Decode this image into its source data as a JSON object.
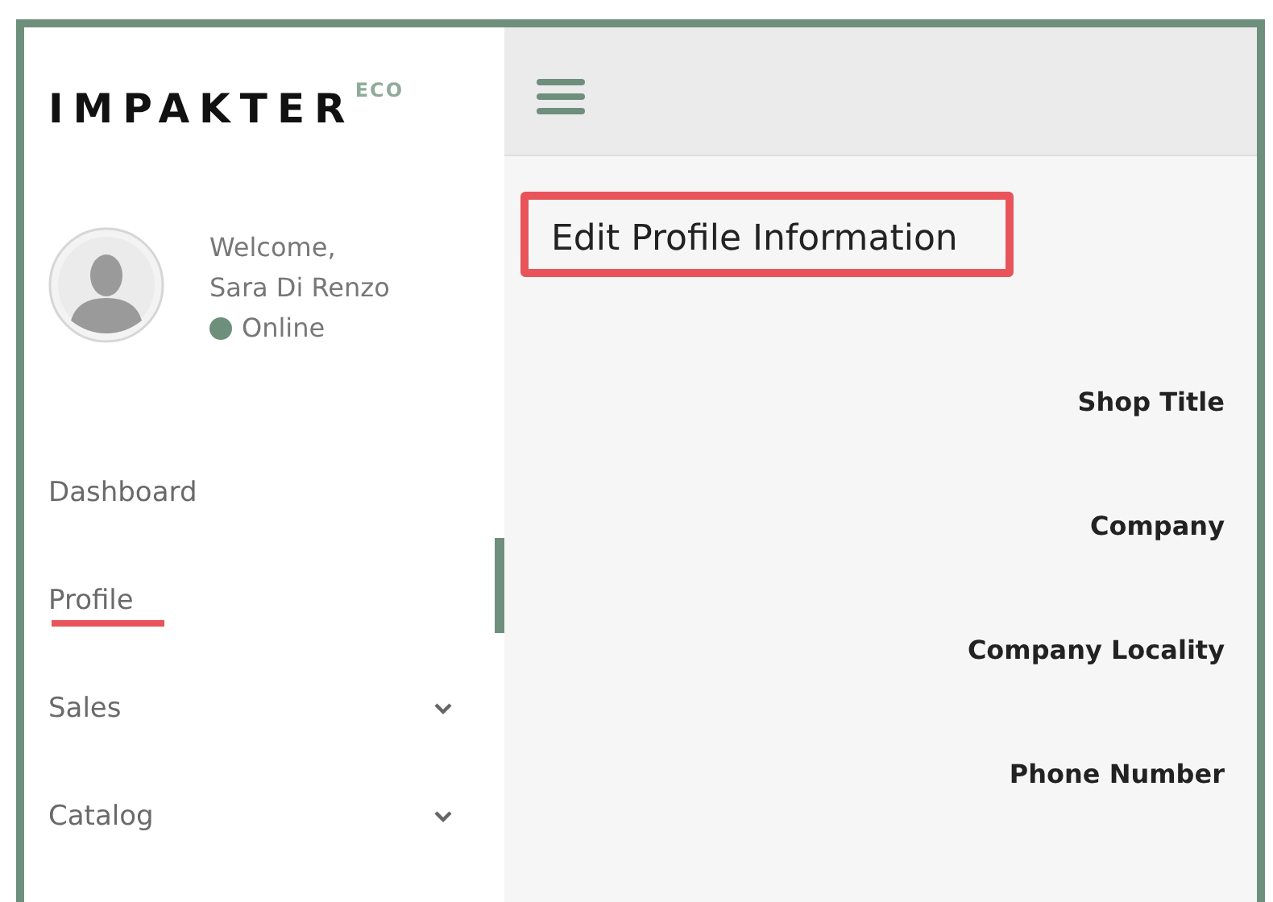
{
  "sidebar": {
    "logo": {
      "wordmark": "IMPAKTER",
      "superscript": "ECO"
    },
    "user": {
      "greeting": "Welcome,",
      "name": "Sara Di Renzo",
      "status": "Online",
      "online": true
    },
    "items": [
      {
        "label": "Dashboard",
        "expandable": false,
        "annotated": false
      },
      {
        "label": "Profile",
        "expandable": false,
        "annotated": true
      },
      {
        "label": "Sales",
        "expandable": true,
        "annotated": false
      },
      {
        "label": "Catalog",
        "expandable": true,
        "annotated": false
      }
    ]
  },
  "main": {
    "heading": {
      "text": "Edit Profile Information",
      "annotated": true
    },
    "form_labels": [
      "Shop Title",
      "Company",
      "Company Locality",
      "Phone Number"
    ]
  }
}
